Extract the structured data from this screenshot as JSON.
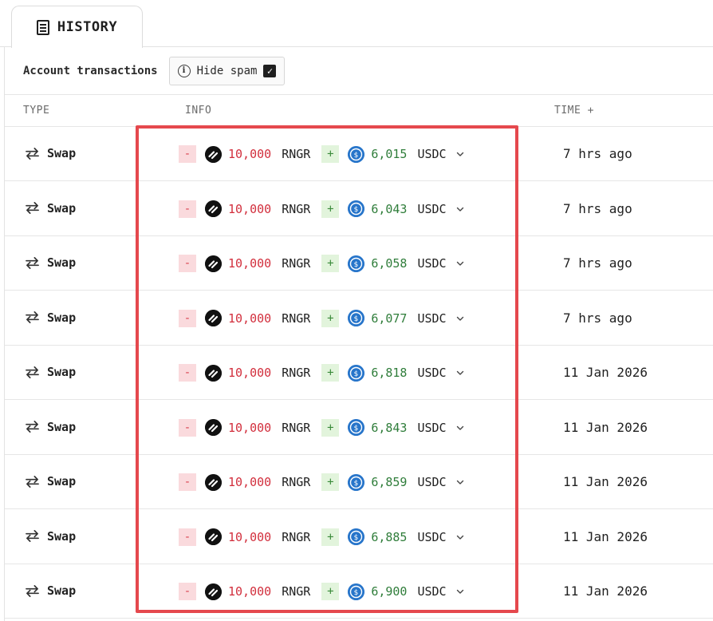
{
  "tab": {
    "icon": "receipt-icon",
    "label": "HISTORY"
  },
  "filters": {
    "label": "Account transactions",
    "hide_spam_label": "Hide spam",
    "hide_spam_checked": true
  },
  "columns": {
    "type": "TYPE",
    "info": "INFO",
    "time": "TIME +"
  },
  "rows": [
    {
      "type": "Swap",
      "sent_sign": "-",
      "sent_amount": "10,000",
      "sent_token": "RNGR",
      "recv_sign": "+",
      "recv_amount": "6,015",
      "recv_token": "USDC",
      "time": "7 hrs ago"
    },
    {
      "type": "Swap",
      "sent_sign": "-",
      "sent_amount": "10,000",
      "sent_token": "RNGR",
      "recv_sign": "+",
      "recv_amount": "6,043",
      "recv_token": "USDC",
      "time": "7 hrs ago"
    },
    {
      "type": "Swap",
      "sent_sign": "-",
      "sent_amount": "10,000",
      "sent_token": "RNGR",
      "recv_sign": "+",
      "recv_amount": "6,058",
      "recv_token": "USDC",
      "time": "7 hrs ago"
    },
    {
      "type": "Swap",
      "sent_sign": "-",
      "sent_amount": "10,000",
      "sent_token": "RNGR",
      "recv_sign": "+",
      "recv_amount": "6,077",
      "recv_token": "USDC",
      "time": "7 hrs ago"
    },
    {
      "type": "Swap",
      "sent_sign": "-",
      "sent_amount": "10,000",
      "sent_token": "RNGR",
      "recv_sign": "+",
      "recv_amount": "6,818",
      "recv_token": "USDC",
      "time": "11 Jan 2026"
    },
    {
      "type": "Swap",
      "sent_sign": "-",
      "sent_amount": "10,000",
      "sent_token": "RNGR",
      "recv_sign": "+",
      "recv_amount": "6,843",
      "recv_token": "USDC",
      "time": "11 Jan 2026"
    },
    {
      "type": "Swap",
      "sent_sign": "-",
      "sent_amount": "10,000",
      "sent_token": "RNGR",
      "recv_sign": "+",
      "recv_amount": "6,859",
      "recv_token": "USDC",
      "time": "11 Jan 2026"
    },
    {
      "type": "Swap",
      "sent_sign": "-",
      "sent_amount": "10,000",
      "sent_token": "RNGR",
      "recv_sign": "+",
      "recv_amount": "6,885",
      "recv_token": "USDC",
      "time": "11 Jan 2026"
    },
    {
      "type": "Swap",
      "sent_sign": "-",
      "sent_amount": "10,000",
      "sent_token": "RNGR",
      "recv_sign": "+",
      "recv_amount": "6,900",
      "recv_token": "USDC",
      "time": "11 Jan 2026"
    }
  ],
  "colors": {
    "negative": "#d22f3d",
    "positive": "#2f7d3a",
    "highlight": "#e5484d",
    "usdc": "#2775ca"
  }
}
